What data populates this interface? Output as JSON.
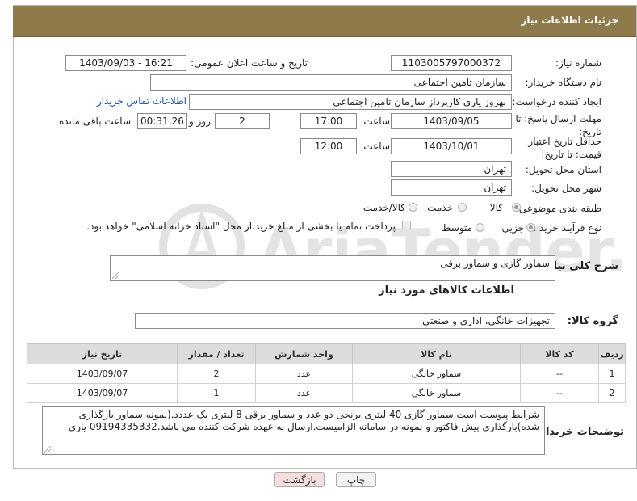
{
  "header": {
    "title": "جزئیات اطلاعات نیاز"
  },
  "form": {
    "need_number_label": "شماره نیاز:",
    "need_number": "1103005797000372",
    "announce_label": "تاریخ و ساعت اعلان عمومی:",
    "announce_value": "1403/09/03 - 16:21",
    "buyer_org_label": "نام دستگاه خریدار:",
    "buyer_org": "سازمان تامین اجتماعی",
    "requester_label": "ایجاد کننده درخواست:",
    "requester": "بهروز یاری کارپرداز سازمان تامین اجتماعی",
    "contact_link": "اطلاعات تماس خریدار",
    "deadline_label": "مهلت ارسال پاسخ: تا تاریخ:",
    "deadline_date": "1403/09/05",
    "time_label": "ساعت",
    "deadline_time": "17:00",
    "days_value": "2",
    "days_label": "روز و",
    "remaining_time": "00:31:26",
    "remaining_label": "ساعت باقی مانده",
    "validity_label": "حداقل تاریخ اعتبار قیمت: تا تاریخ:",
    "validity_date": "1403/10/01",
    "validity_time": "12:00",
    "province_label": "استان محل تحویل:",
    "province": "تهران",
    "city_label": "شهر محل تحویل:",
    "city": "تهران",
    "category_label": "طبقه بندی موضوعی:",
    "category_options": [
      "کالا",
      "خدمت",
      "کالا/خدمت"
    ],
    "process_label": "نوع فرآیند خرید :",
    "process_options": [
      "جزیی",
      "متوسط"
    ],
    "payment_note": "پرداخت تمام یا بخشی از مبلغ خرید،از محل \"اسناد خزانه اسلامی\" خواهد بود."
  },
  "description": {
    "label": "شرح کلی نیاز:",
    "value": "سماور گازی و سماور برقی"
  },
  "goods": {
    "section_title": "اطلاعات کالاهای مورد نیاز",
    "group_label": "گروه کالا:",
    "group_value": "تجهیزات خانگی، اداری و صنعتی",
    "columns": [
      "ردیف",
      "کد کالا",
      "نام کالا",
      "واحد شمارش",
      "تعداد / مقدار",
      "تاریخ نیاز"
    ],
    "rows": [
      [
        "1",
        "--",
        "سماور خانگی",
        "عدد",
        "2",
        "1403/09/07"
      ],
      [
        "2",
        "--",
        "سماور خانگی",
        "عدد",
        "1",
        "1403/09/07"
      ]
    ]
  },
  "buyer_notes": {
    "label": "توضیحات خریدار:",
    "value": "شرایط پیوست است.سماور گازی 40 لیتری برنجی دو عدد و سماور برقی 8 لیتری یک عددد.(نمونه سماور بارگذاری شده)بارگذاری پیش فاکتور و نمونه در سامانه الزامیست.ارسال به عهده شرکت کننده می باشد.09194335332 یاری"
  },
  "buttons": {
    "print": "چاپ",
    "back": "بازگشت"
  },
  "colors": {
    "header": "#8e7a4a",
    "back_button": "#f6dede",
    "link": "#1a57a6"
  }
}
